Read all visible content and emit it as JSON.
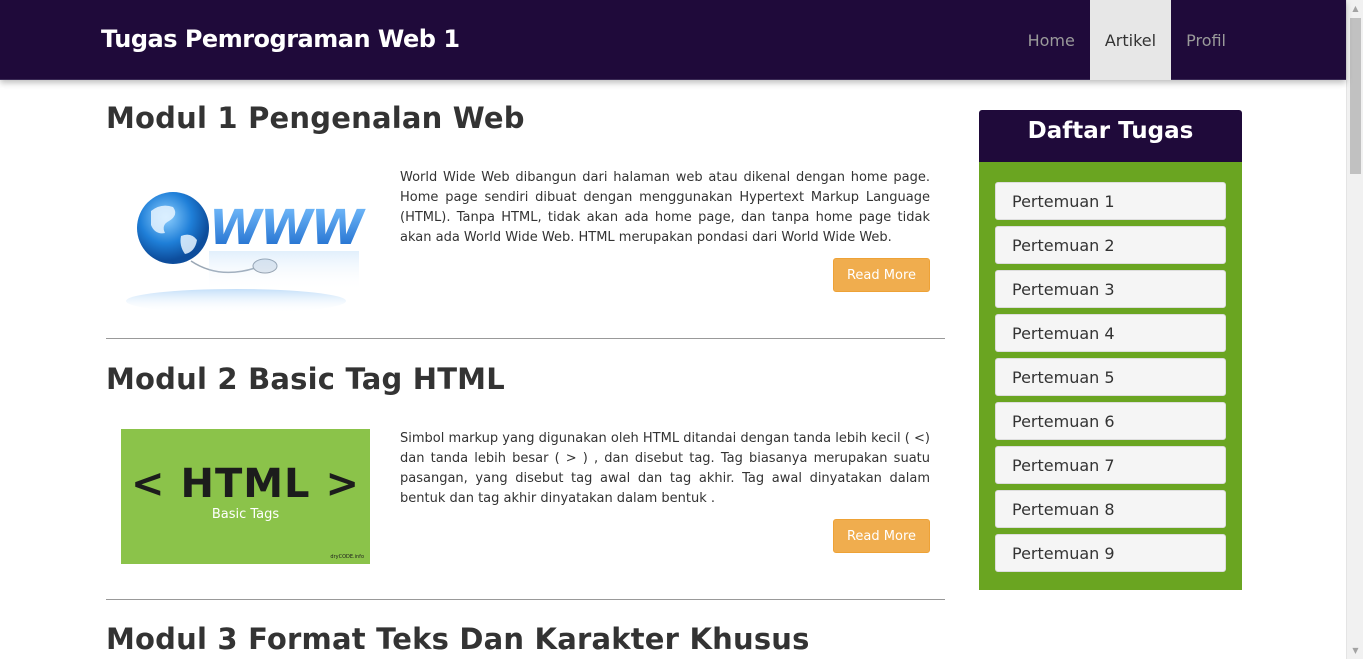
{
  "header": {
    "brand": "Tugas Pemrograman Web 1",
    "nav": [
      {
        "label": "Home",
        "active": false
      },
      {
        "label": "Artikel",
        "active": true
      },
      {
        "label": "Profil",
        "active": false
      }
    ]
  },
  "articles": [
    {
      "title": "Modul 1 Pengenalan Web",
      "image": "www-globe-image",
      "text": "World Wide Web dibangun dari halaman web atau dikenal dengan home page. Home page sendiri dibuat dengan menggunakan Hypertext Markup Language (HTML). Tanpa HTML, tidak akan ada home page, dan tanpa home page tidak akan ada World Wide Web. HTML merupakan pondasi dari World Wide Web.",
      "button": "Read More"
    },
    {
      "title": "Modul 2 Basic Tag HTML",
      "image": "html-basic-tags-image",
      "image_text": {
        "main": "< HTML >",
        "sub": "Basic Tags",
        "credit": "dryCODE.info"
      },
      "text": "Simbol markup yang digunakan oleh HTML ditandai dengan tanda lebih kecil ( <) dan tanda lebih besar ( > ) , dan disebut tag. Tag biasanya merupakan suatu pasangan, yang disebut tag awal dan tag akhir. Tag awal dinyatakan dalam bentuk dan tag akhir dinyatakan dalam bentuk .",
      "button": "Read More"
    },
    {
      "title": "Modul 3 Format Teks Dan Karakter Khusus"
    }
  ],
  "sidebar": {
    "title": "Daftar Tugas",
    "items": [
      "Pertemuan 1",
      "Pertemuan 2",
      "Pertemuan 3",
      "Pertemuan 4",
      "Pertemuan 5",
      "Pertemuan 6",
      "Pertemuan 7",
      "Pertemuan 8",
      "Pertemuan 9"
    ]
  },
  "colors": {
    "header_bg": "#1f0a3a",
    "sidebar_body": "#6aa521",
    "button": "#f0ad4e",
    "html_image_bg": "#8bc34a"
  }
}
